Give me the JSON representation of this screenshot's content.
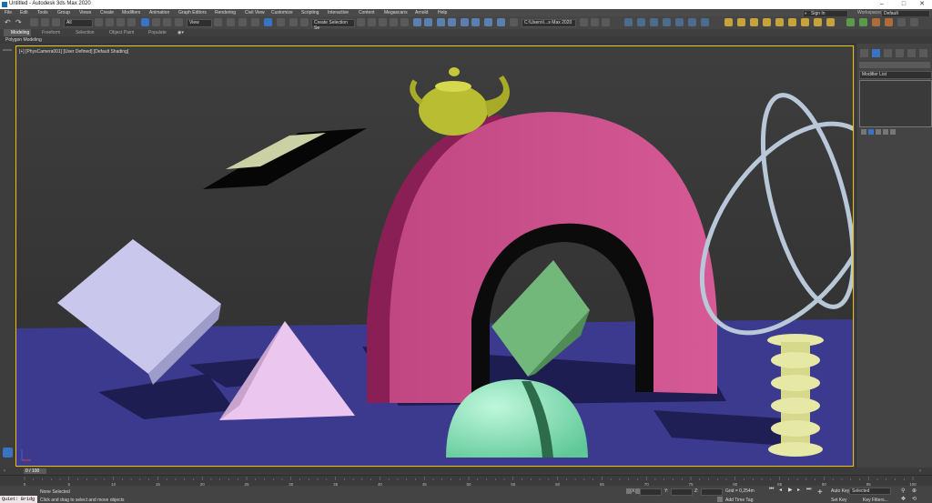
{
  "window": {
    "title": "Untitled - Autodesk 3ds Max 2020",
    "minimize": "–",
    "maximize": "□",
    "close": "✕"
  },
  "menu": [
    "File",
    "Edit",
    "Tools",
    "Group",
    "Views",
    "Create",
    "Modifiers",
    "Animation",
    "Graph Editors",
    "Rendering",
    "Civil View",
    "Customize",
    "Scripting",
    "Interactive",
    "Content",
    "Megascans",
    "Arnold",
    "Help"
  ],
  "account": {
    "sign_in": "Sign In",
    "workspaces_label": "Workspaces:",
    "workspace_value": "Default"
  },
  "toolbar": {
    "selection_filter": "All",
    "ref_coord": "View",
    "named_selection": "Create Selection Se",
    "project_path": "C:\\Users\\\\...s Max 2020"
  },
  "ribbon": {
    "tabs": [
      "Modeling",
      "Freeform",
      "Selection",
      "Object Paint",
      "Populate"
    ],
    "sub_label": "Polygon Modeling"
  },
  "viewport": {
    "label": "[+] [PhysCamera001] [User Defined] [Default Shading]"
  },
  "cmdpanel": {
    "modifier_list": "Modifier List"
  },
  "timeline": {
    "frame_counter": "0 / 100",
    "ticks": [
      "0",
      "5",
      "10",
      "15",
      "20",
      "25",
      "30",
      "35",
      "40",
      "45",
      "50",
      "55",
      "60",
      "65",
      "70",
      "75",
      "80",
      "85",
      "90",
      "95",
      "100"
    ]
  },
  "status": {
    "script_listener": "Quiet: Bridg",
    "selection_status": "None Selected",
    "prompt": "Click and drag to select and move objects",
    "x_label": "X:",
    "y_label": "Y:",
    "z_label": "Z:",
    "grid": "Grid = 0,254m",
    "add_time_tag": "Add Time Tag",
    "auto_key": "Auto Key",
    "set_key": "Set Key",
    "selected_dropdown": "Selected",
    "key_filters": "Key Filters..."
  },
  "colors": {
    "floor": "#3b3a8e",
    "arch": "#c44d86",
    "teapot": "#b9bd32",
    "active_border": "#f0c000"
  }
}
